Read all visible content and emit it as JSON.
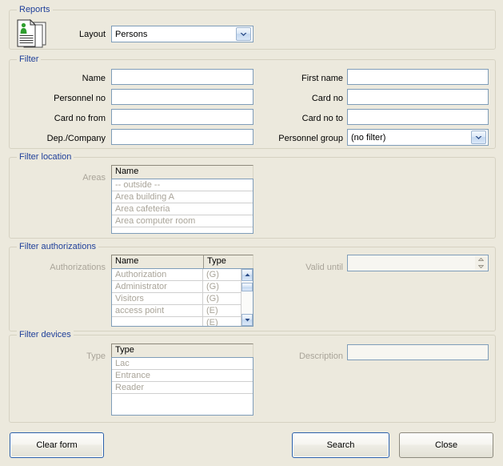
{
  "window": {
    "title": "Reports",
    "background_color": "#ece9dd",
    "legend_color": "#20409a"
  },
  "reports": {
    "legend": "Reports",
    "icon": "documents-person-icon",
    "layout_label": "Layout",
    "layout_value": "Persons",
    "layout_options": [
      "Persons"
    ]
  },
  "filter": {
    "legend": "Filter",
    "fields": {
      "name_label": "Name",
      "name_value": "",
      "first_name_label": "First name",
      "first_name_value": "",
      "personnel_no_label": "Personnel no",
      "personnel_no_value": "",
      "card_no_label": "Card no",
      "card_no_value": "",
      "card_no_from_label": "Card no from",
      "card_no_from_value": "",
      "card_no_to_label": "Card no to",
      "card_no_to_value": "",
      "dep_company_label": "Dep./Company",
      "dep_company_value": "",
      "personnel_group_label": "Personnel group",
      "personnel_group_value": "(no filter)",
      "personnel_group_options": [
        "(no filter)"
      ]
    }
  },
  "filter_location": {
    "legend": "Filter location",
    "areas_label": "Areas",
    "columns": [
      "Name"
    ],
    "rows": [
      [
        "-- outside --"
      ],
      [
        "Area building A"
      ],
      [
        "Area cafeteria"
      ],
      [
        "Area computer room"
      ],
      [
        ""
      ]
    ]
  },
  "filter_authorizations": {
    "legend": "Filter authorizations",
    "authorizations_label": "Authorizations",
    "columns": [
      "Name",
      "Type"
    ],
    "rows": [
      [
        "Authorization",
        "(G)"
      ],
      [
        "Administrator",
        "(G)"
      ],
      [
        "Visitors",
        "(G)"
      ],
      [
        "access point",
        "(E)"
      ],
      [
        "",
        "(E)"
      ]
    ],
    "valid_until_label": "Valid until",
    "valid_until_value": ""
  },
  "filter_devices": {
    "legend": "Filter devices",
    "type_label": "Type",
    "columns": [
      "Type"
    ],
    "rows": [
      [
        "Lac"
      ],
      [
        "Entrance"
      ],
      [
        "Reader"
      ],
      [
        ""
      ],
      [
        ""
      ]
    ],
    "description_label": "Description",
    "description_value": ""
  },
  "footer": {
    "clear_form_label": "Clear form",
    "search_label": "Search",
    "close_label": "Close"
  }
}
